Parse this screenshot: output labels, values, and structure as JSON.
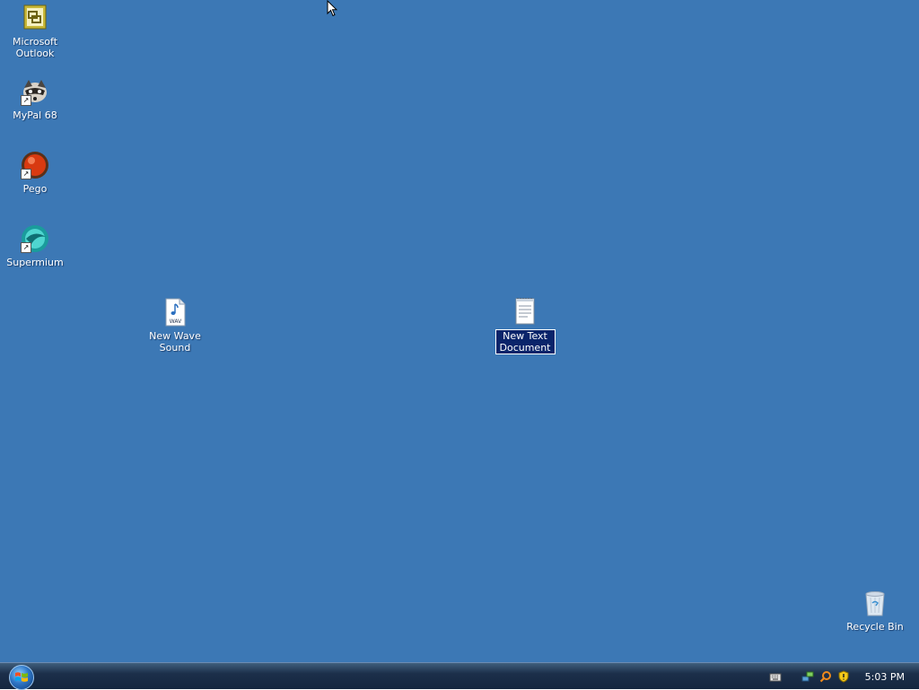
{
  "desktop": {
    "background_color": "#3c78b5",
    "icons": [
      {
        "name": "Microsoft\nOutlook",
        "icon": "outlook-icon"
      },
      {
        "name": "MyPal 68",
        "icon": "mypal-icon"
      },
      {
        "name": "Pego",
        "icon": "pego-icon"
      },
      {
        "name": "Supermium",
        "icon": "supermium-icon"
      },
      {
        "name": "New Wave\nSound",
        "icon": "wav-file-icon"
      },
      {
        "name": "New Text\nDocument",
        "icon": "text-document-icon",
        "selected": true,
        "renaming": true
      },
      {
        "name": "Recycle Bin",
        "icon": "recycle-bin-icon"
      }
    ]
  },
  "taskbar": {
    "start_icon": "windows-orb-icon",
    "tray_icons": [
      "keyboard-icon",
      "network-icon",
      "search-icon",
      "security-shield-icon"
    ],
    "clock": "5:03 PM"
  }
}
